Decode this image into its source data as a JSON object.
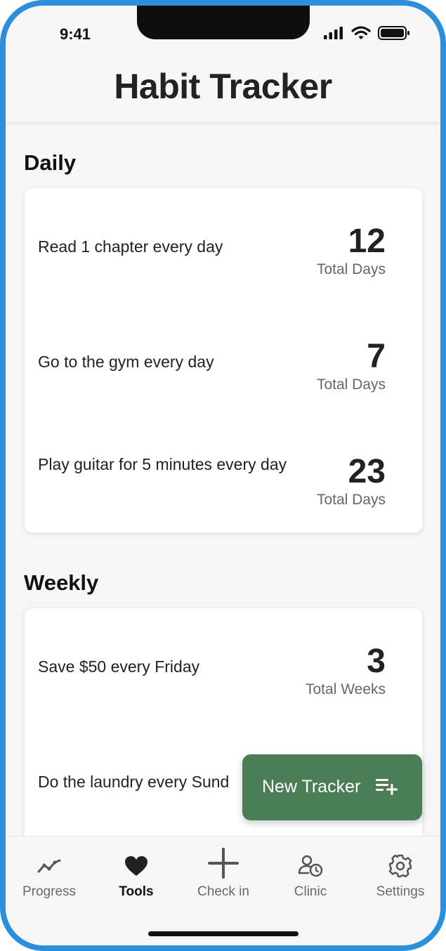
{
  "status_bar": {
    "time": "9:41"
  },
  "header": {
    "title": "Habit Tracker"
  },
  "sections": [
    {
      "title": "Daily",
      "items": [
        {
          "label": "Read 1 chapter every day",
          "count": "12",
          "unit": "Total Days"
        },
        {
          "label": "Go to the gym every day",
          "count": "7",
          "unit": "Total Days"
        },
        {
          "label": "Play guitar for 5 minutes every day",
          "count": "23",
          "unit": "Total Days"
        }
      ]
    },
    {
      "title": "Weekly",
      "items": [
        {
          "label": "Save $50 every Friday",
          "count": "3",
          "unit": "Total Weeks"
        },
        {
          "label": "Do the laundry every Sund"
        }
      ]
    }
  ],
  "fab": {
    "label": "New Tracker",
    "icon": "playlist-add-icon"
  },
  "tabbar": {
    "tabs": [
      {
        "label": "Progress",
        "icon": "trend-line-icon",
        "active": false
      },
      {
        "label": "Tools",
        "icon": "heart-icon",
        "active": true
      },
      {
        "label": "Check in",
        "icon": "plus-icon",
        "active": false
      },
      {
        "label": "Clinic",
        "icon": "person-clock-icon",
        "active": false
      },
      {
        "label": "Settings",
        "icon": "gear-icon",
        "active": false
      }
    ]
  },
  "colors": {
    "frame": "#2b8fdc",
    "accent": "#4b7d56",
    "background": "#f6f6f6",
    "card": "#ffffff"
  }
}
